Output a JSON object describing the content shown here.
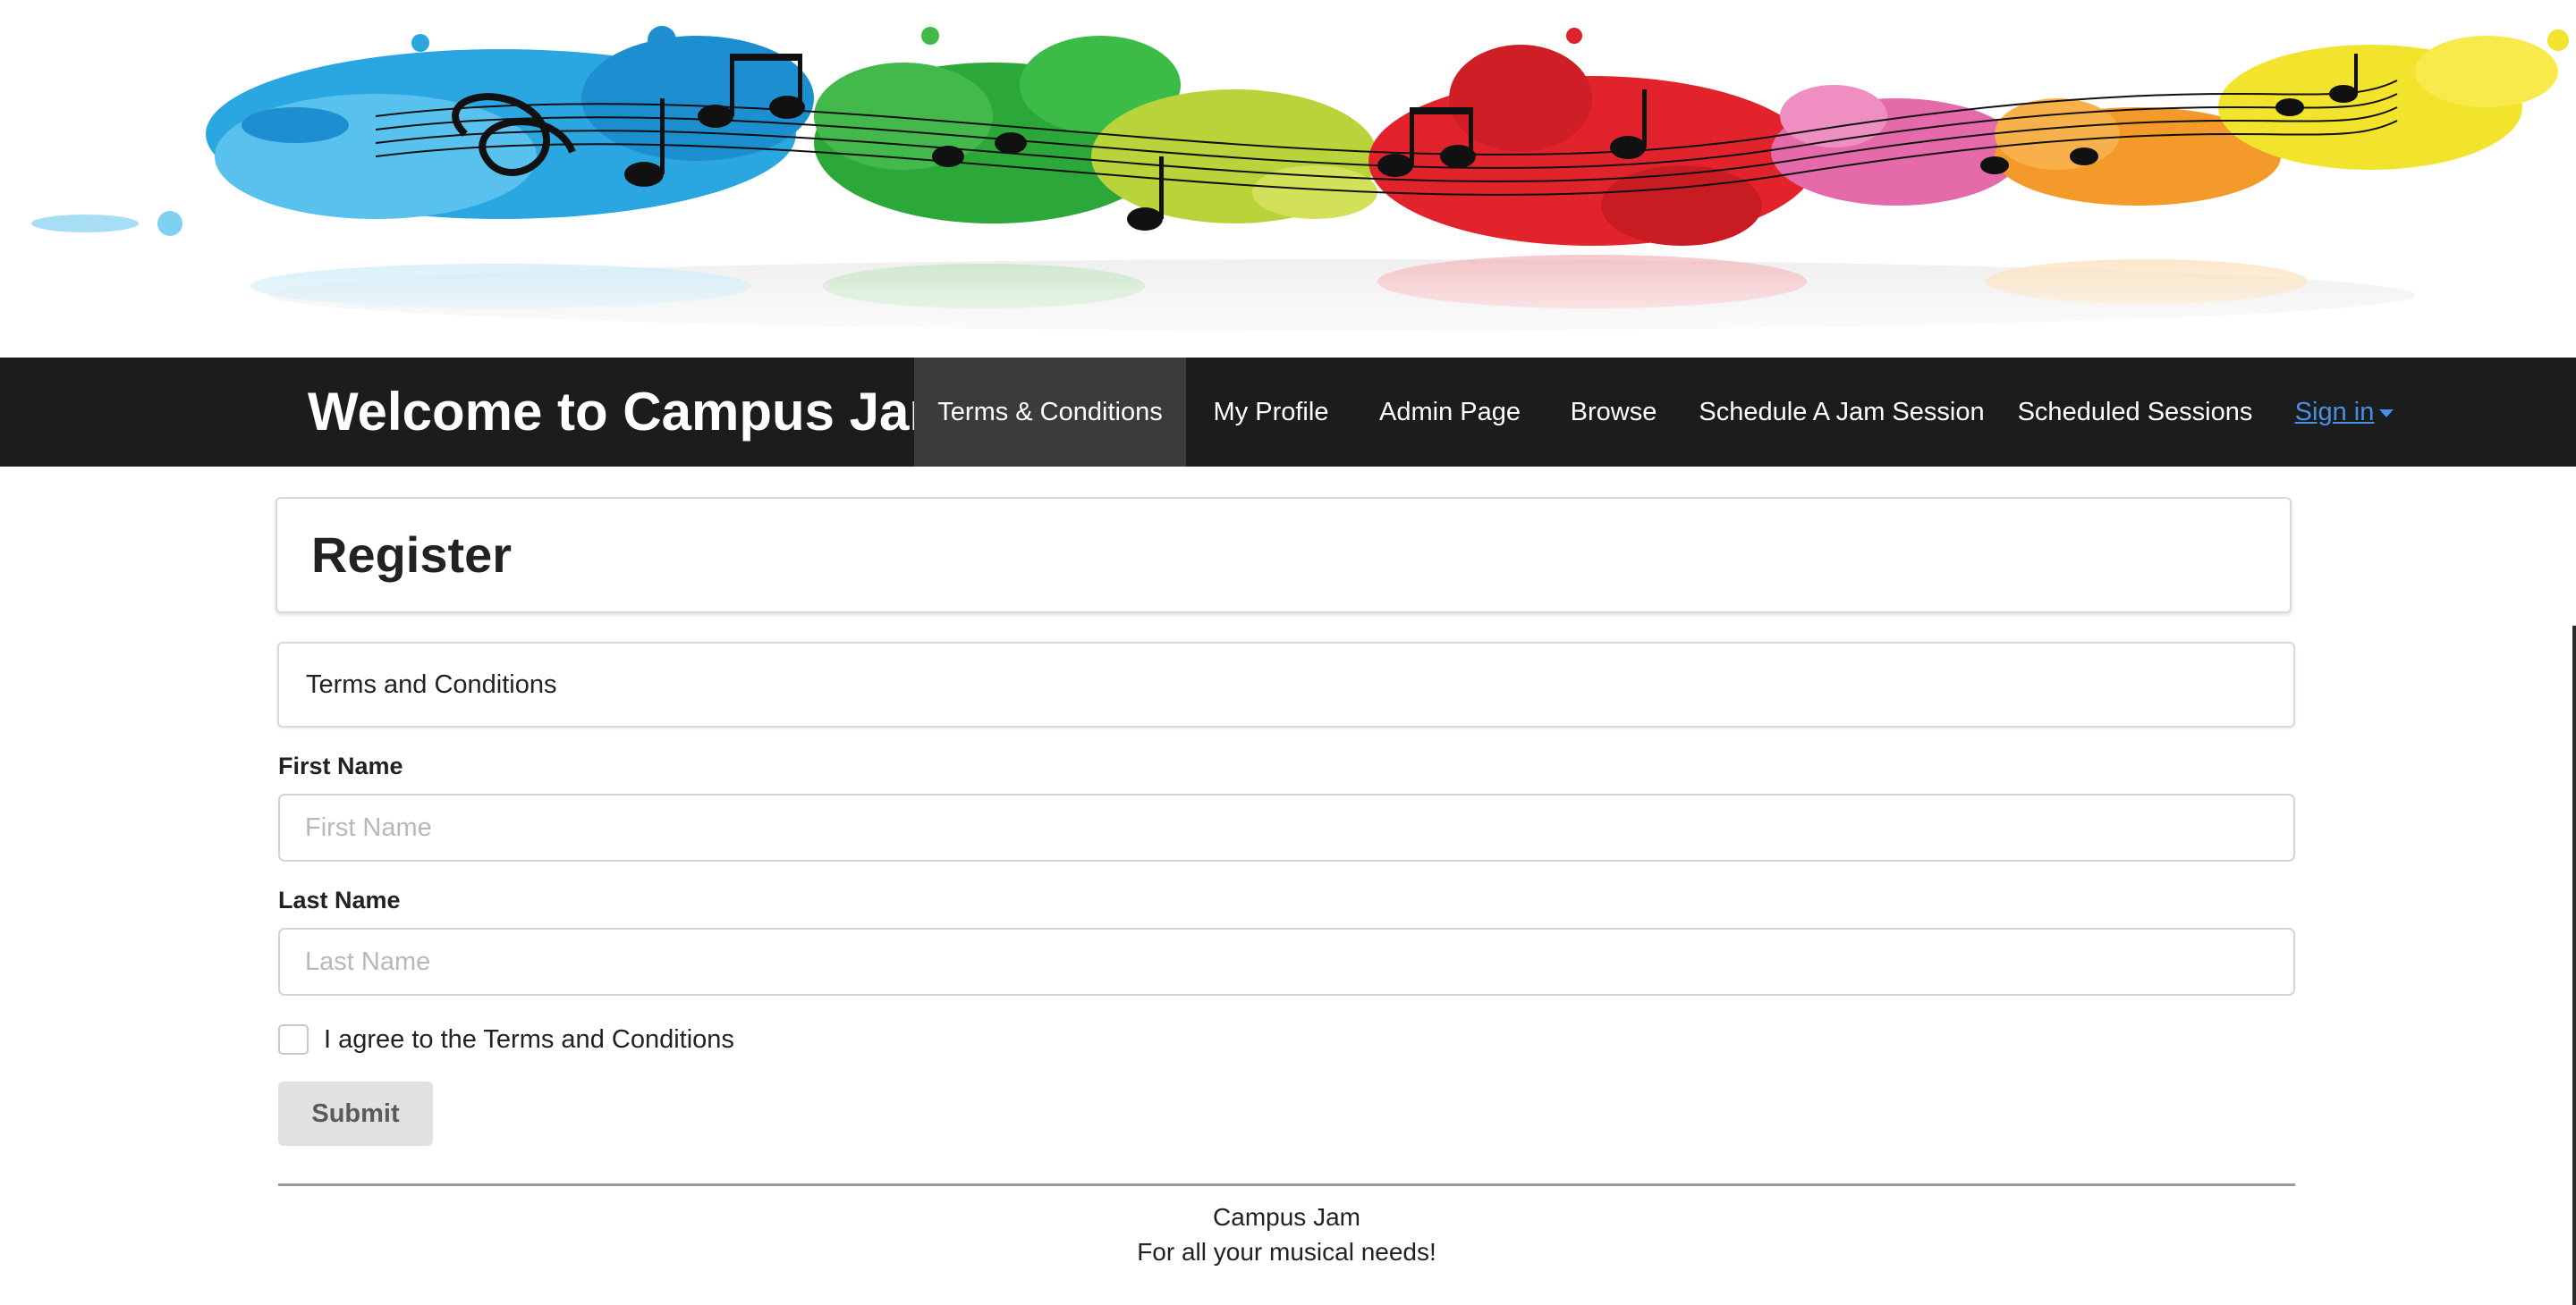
{
  "banner": {
    "image_name": "paint-splash-music-notes-banner"
  },
  "navbar": {
    "brand": "Welcome to Campus Jam!",
    "items": [
      {
        "label": "Terms & Conditions",
        "active": true
      },
      {
        "label": "My Profile",
        "active": false
      },
      {
        "label": "Admin Page",
        "active": false
      },
      {
        "label": "Browse",
        "active": false
      },
      {
        "label": "Schedule A Jam Session",
        "active": false
      },
      {
        "label": "Scheduled Sessions",
        "active": false
      }
    ],
    "signin": {
      "label": "Sign in",
      "icon": "caret-down-icon"
    }
  },
  "page": {
    "title": "Register",
    "terms_box_text": "Terms and Conditions"
  },
  "form": {
    "first_name": {
      "label": "First Name",
      "placeholder": "First Name",
      "value": ""
    },
    "last_name": {
      "label": "Last Name",
      "placeholder": "Last Name",
      "value": ""
    },
    "agree": {
      "label": "I agree to the Terms and Conditions",
      "checked": false
    },
    "submit_label": "Submit"
  },
  "footer": {
    "line1": "Campus Jam",
    "line2": "For all your musical needs!"
  },
  "colors": {
    "navbar_bg": "#1b1c1d",
    "navbar_active": "#3a3b3c",
    "link": "#4a90e2",
    "button_bg": "#e0e1e2"
  }
}
